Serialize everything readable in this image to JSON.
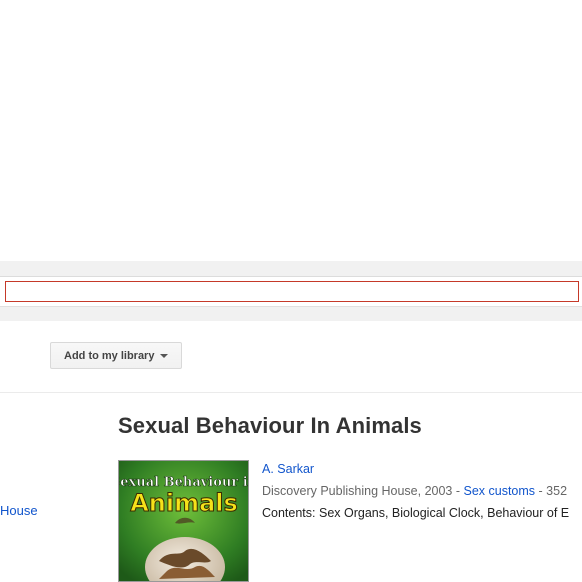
{
  "toolbar": {
    "library_button_label": "Add to my library"
  },
  "left_panel": {
    "link_text": "House"
  },
  "book": {
    "title": "Sexual Behaviour In Animals",
    "author": "A. Sarkar",
    "publisher_year": "Discovery Publishing House, 2003 - ",
    "subject": "Sex customs",
    "pages_fragment": " - 352",
    "contents": "Contents: Sex Organs, Biological Clock, Behaviour of E",
    "cover": {
      "line1": "Sexual Behaviour in",
      "line2": "Animals"
    }
  },
  "colors": {
    "link": "#1155cc",
    "search_border": "#c53929",
    "band": "#f1f1f1"
  }
}
